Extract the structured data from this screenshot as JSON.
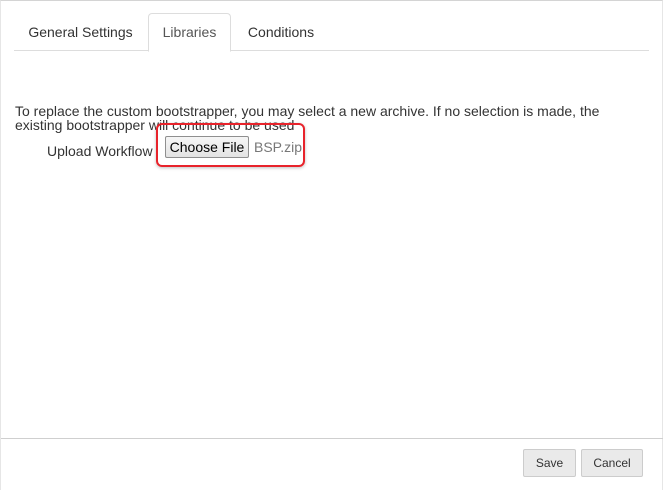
{
  "tabs": [
    {
      "label": "General Settings"
    },
    {
      "label": "Libraries",
      "active": true
    },
    {
      "label": "Conditions"
    }
  ],
  "libraries": {
    "description": "To replace the custom bootstrapper, you may select a new archive. If no selection is made, the existing bootstrapper will continue to be used",
    "upload_label": "Upload Workflow",
    "choose_file_label": "Choose File",
    "file_name": "BSP.zip"
  },
  "footer": {
    "save_label": "Save",
    "cancel_label": "Cancel"
  },
  "colors": {
    "highlight_border": "#e8232b"
  }
}
